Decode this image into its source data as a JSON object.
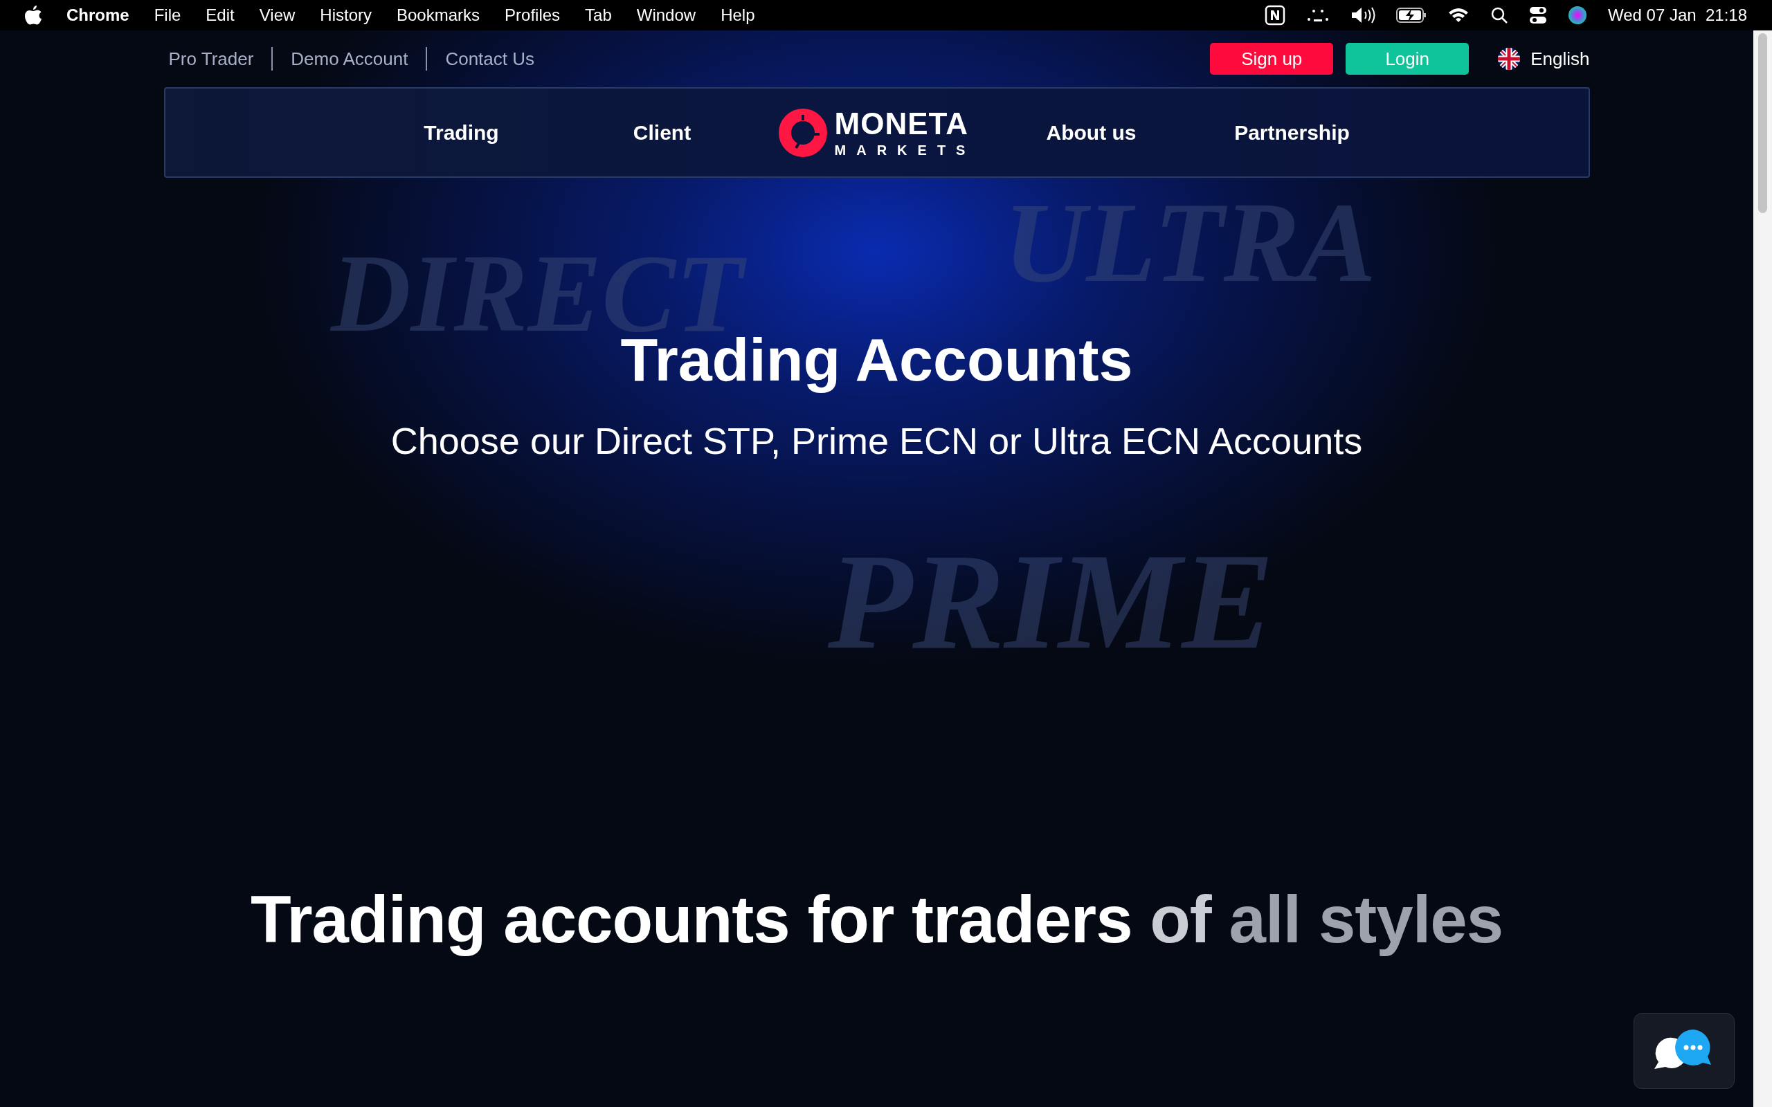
{
  "menubar": {
    "app": "Chrome",
    "items": [
      "File",
      "Edit",
      "View",
      "History",
      "Bookmarks",
      "Profiles",
      "Tab",
      "Window",
      "Help"
    ],
    "clock": "Wed 07 Jan  21:18"
  },
  "top_links": [
    "Pro Trader",
    "Demo Account",
    "Contact Us"
  ],
  "buttons": [
    {
      "label": "Sign up",
      "kind": "signup"
    },
    {
      "label": "Login",
      "kind": "login"
    }
  ],
  "language": "English",
  "nav": {
    "left": [
      "Trading",
      "Client"
    ],
    "logo": {
      "name": "MONETA",
      "sub": "MARKETS"
    },
    "right": [
      "About us",
      "Partnership"
    ]
  },
  "hero": {
    "backdrop_words": [
      "DIRECT",
      "ULTRA",
      "PRIME"
    ],
    "title": "Trading Accounts",
    "subtitle": "Choose our Direct STP, Prime ECN or Ultra ECN Accounts"
  },
  "section_heading": [
    {
      "text": "Trading accounts for traders",
      "color": "#ffffff"
    },
    {
      "text": "of",
      "color": "#c9ccd3"
    },
    {
      "text": "all styles",
      "color": "#9ea2ab"
    }
  ]
}
